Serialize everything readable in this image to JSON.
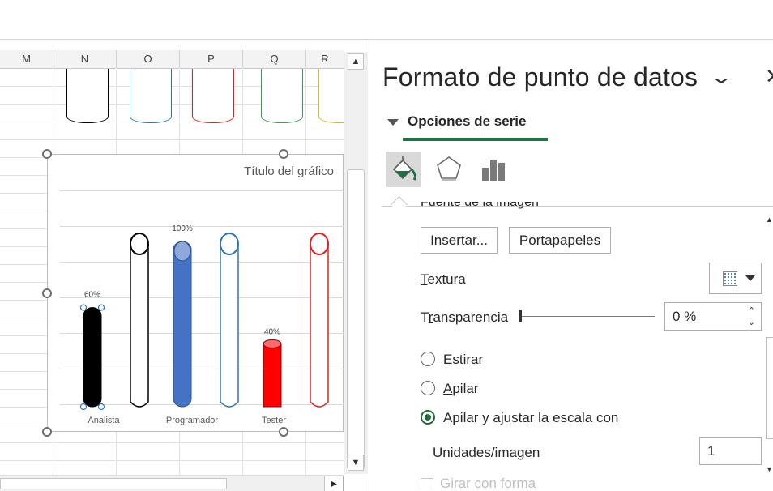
{
  "sheet": {
    "columns": [
      "M",
      "N",
      "O",
      "P",
      "Q",
      "R"
    ]
  },
  "chart": {
    "title": "Título del gráfico"
  },
  "chart_data": {
    "type": "bar",
    "title": "Título del gráfico",
    "categories": [
      "Analista",
      "Programador",
      "Tester"
    ],
    "series": [
      {
        "values": [
          60,
          100,
          40
        ],
        "colors": [
          "#000000",
          "#4472c4",
          "#ff0000"
        ]
      }
    ],
    "data_labels": [
      "60%",
      "100%",
      "40%"
    ],
    "ylim": [
      0,
      100
    ],
    "grid": true
  },
  "pane": {
    "title": "Formato de punto de datos",
    "series_options_label": "Opciones de serie",
    "cut_text": "Fuente de la imagen",
    "insert_button": "Insertar...",
    "clipboard_button": "Portapapeles",
    "texture_label": "Textura",
    "transparency_label": "Transparencia",
    "transparency_value": "0 %",
    "stretch_label": "Estirar",
    "stack_label": "Apilar",
    "stack_scale_label": "Apilar y ajustar la escala con",
    "units_label": "Unidades/imagen",
    "units_value": "1",
    "rotate_label": "Girar con forma",
    "transparency_level": 0,
    "selected_fill_mode": "stack_scale"
  },
  "icons": {
    "fill": "paint-bucket-icon",
    "effects": "pentagon-icon",
    "series": "bar-chart-icon"
  },
  "colors": {
    "accent": "#217346",
    "series_black": "#000000",
    "series_blue": "#4472c4",
    "series_red": "#ff0000",
    "tube_blue": "#2e75b6",
    "tube_green": "#3a9b53",
    "tube_orange": "#f0b400"
  }
}
